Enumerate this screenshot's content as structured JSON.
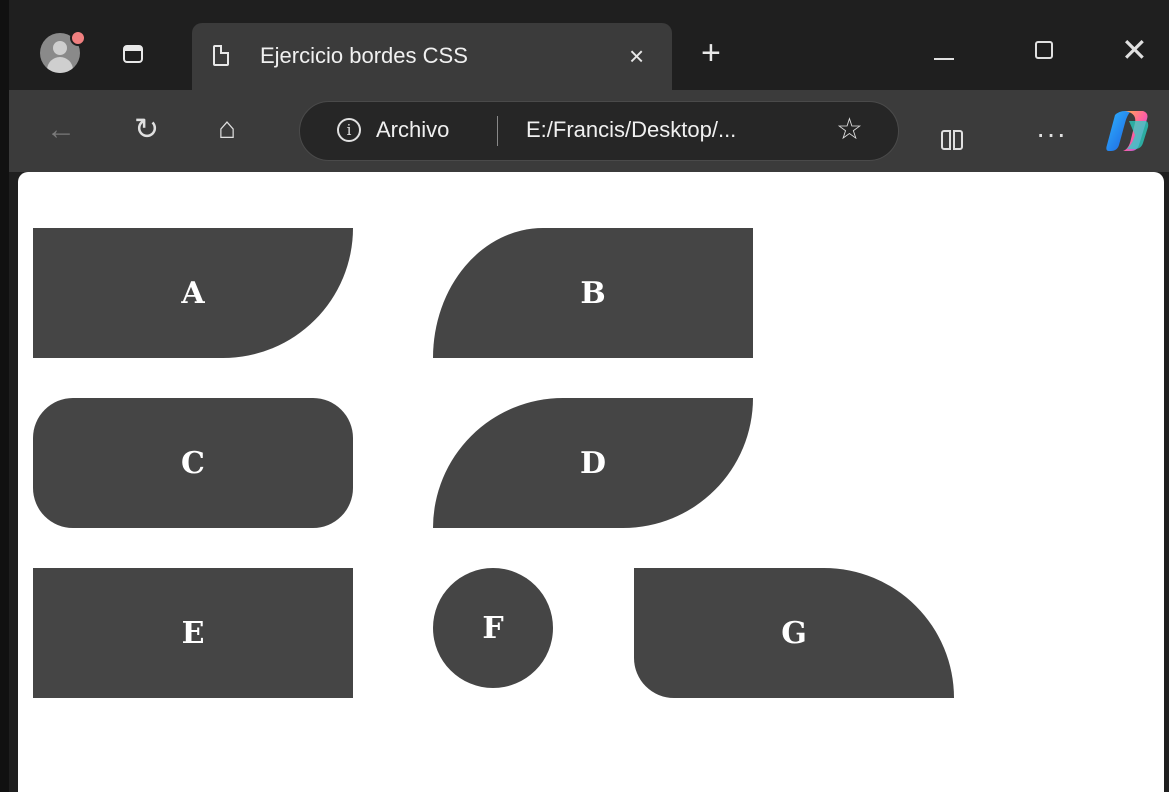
{
  "browser": {
    "tab_title": "Ejercicio bordes CSS",
    "tab_close": "×",
    "new_tab": "+",
    "window_close": "✕",
    "address_label": "Archivo",
    "address_url": "E:/Francis/Desktop/...",
    "more_label": "···",
    "star_glyph": "☆",
    "back_glyph": "←",
    "reload_glyph": "↻",
    "home_glyph": "⌂",
    "info_glyph": "i"
  },
  "page": {
    "boxes": [
      {
        "label": "A"
      },
      {
        "label": "B"
      },
      {
        "label": "C"
      },
      {
        "label": "D"
      },
      {
        "label": "E"
      },
      {
        "label": "F"
      },
      {
        "label": "G"
      }
    ]
  },
  "colors": {
    "box_fill": "#454545",
    "box_text": "#ffffff",
    "page_background": "#ffffff",
    "chrome_dark": "#1f1f1f",
    "toolbar": "#3b3b3b"
  }
}
